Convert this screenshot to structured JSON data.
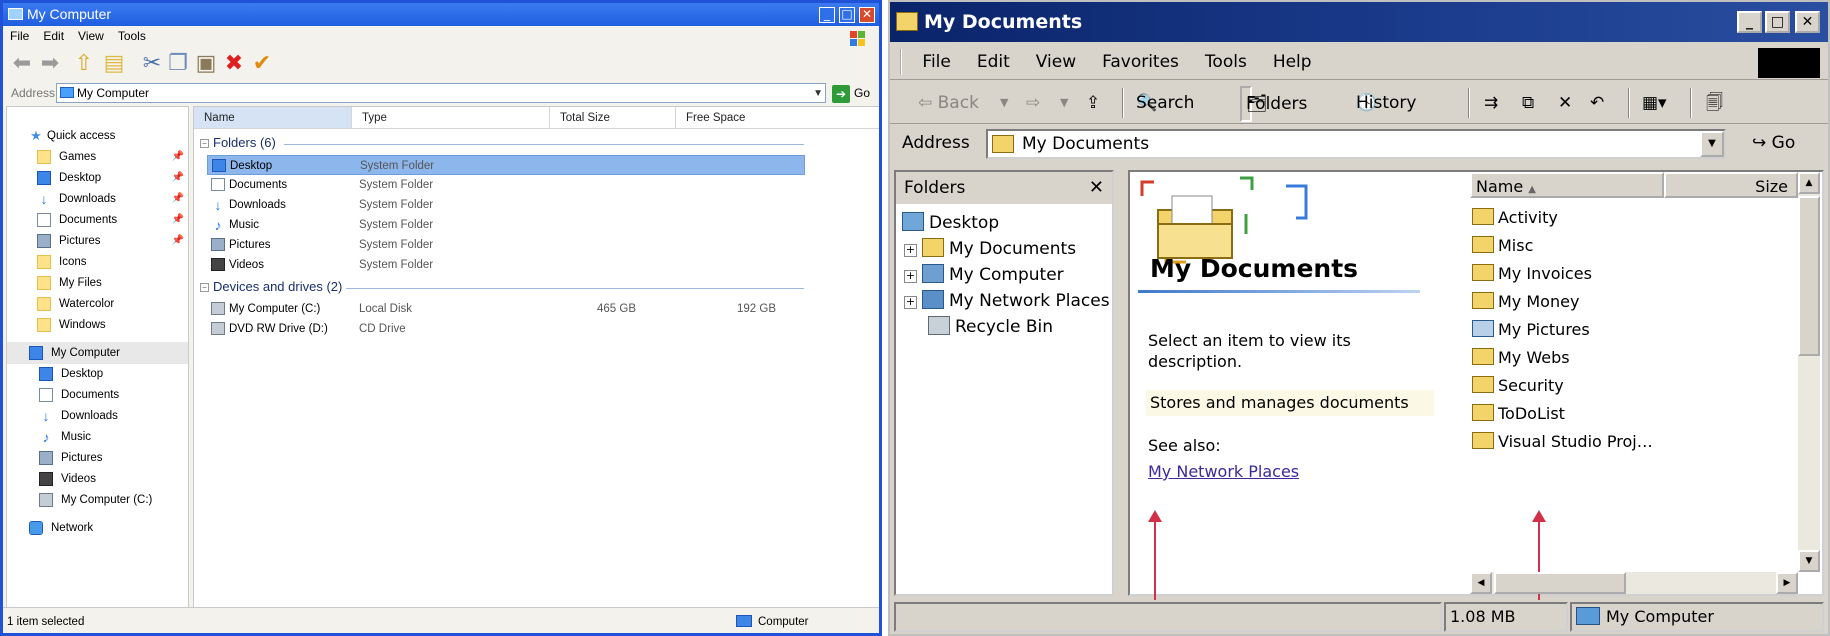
{
  "left_window": {
    "title": "My Computer",
    "window_buttons": [
      "_",
      "□",
      "✕"
    ],
    "menu": [
      "File",
      "Edit",
      "View",
      "Tools"
    ],
    "address_label": "Address",
    "address_value": "My Computer",
    "go_label": "Go",
    "nav": {
      "quick_access": "Quick access",
      "quick_items": [
        "Games",
        "Desktop",
        "Downloads",
        "Documents",
        "Pictures",
        "Icons",
        "My Files",
        "Watercolor",
        "Windows"
      ],
      "my_computer": "My Computer",
      "computer_items": [
        "Desktop",
        "Documents",
        "Downloads",
        "Music",
        "Pictures",
        "Videos",
        "My Computer (C:)"
      ],
      "network": "Network"
    },
    "columns": [
      "Name",
      "Type",
      "Total Size",
      "Free Space"
    ],
    "folders_group": "Folders (6)",
    "folders": [
      {
        "name": "Desktop",
        "type": "System Folder",
        "icon": "desktop-icon"
      },
      {
        "name": "Documents",
        "type": "System Folder",
        "icon": "documents-icon"
      },
      {
        "name": "Downloads",
        "type": "System Folder",
        "icon": "downloads-icon"
      },
      {
        "name": "Music",
        "type": "System Folder",
        "icon": "music-icon"
      },
      {
        "name": "Pictures",
        "type": "System Folder",
        "icon": "pictures-icon"
      },
      {
        "name": "Videos",
        "type": "System Folder",
        "icon": "videos-icon"
      }
    ],
    "drives_group": "Devices and drives (2)",
    "drives": [
      {
        "name": "My Computer (C:)",
        "type": "Local Disk",
        "total": "465 GB",
        "free": "192 GB"
      },
      {
        "name": "DVD RW Drive (D:)",
        "type": "CD Drive",
        "total": "",
        "free": ""
      }
    ],
    "status_left": "1 item selected",
    "status_right": "Computer"
  },
  "right_window": {
    "title": "My Documents",
    "window_buttons": [
      "_",
      "□",
      "✕"
    ],
    "menu": [
      "File",
      "Edit",
      "View",
      "Favorites",
      "Tools",
      "Help"
    ],
    "toolbar": {
      "back": "⇦ Back",
      "forward": "⇨",
      "search": "Search",
      "folders": "Folders",
      "history": "History"
    },
    "address_label": "Address",
    "address_value": "My Documents",
    "go_label": "Go",
    "folders_pane_title": "Folders",
    "tree": [
      "Desktop",
      "My Documents",
      "My Computer",
      "My Network Places",
      "Recycle Bin"
    ],
    "web_title": "My Documents",
    "web_desc": "Select an item to view its description.",
    "web_info": "Stores and manages documents",
    "see_also": "See also:",
    "see_also_link": "My Network Places",
    "list_columns": [
      "Name",
      "Size"
    ],
    "list_items": [
      "Activity",
      "Misc",
      "My Invoices",
      "My Money",
      "My Pictures",
      "My Webs",
      "Security",
      "ToDoList",
      "Visual Studio Proj…"
    ],
    "status_size": "1.08 MB",
    "status_location": "My Computer"
  },
  "colors": {
    "xp_blue": "#1f52d6",
    "selection": "#8db6ec",
    "classic_gray": "#d8d4cc",
    "arrow_red": "#d0304a"
  }
}
